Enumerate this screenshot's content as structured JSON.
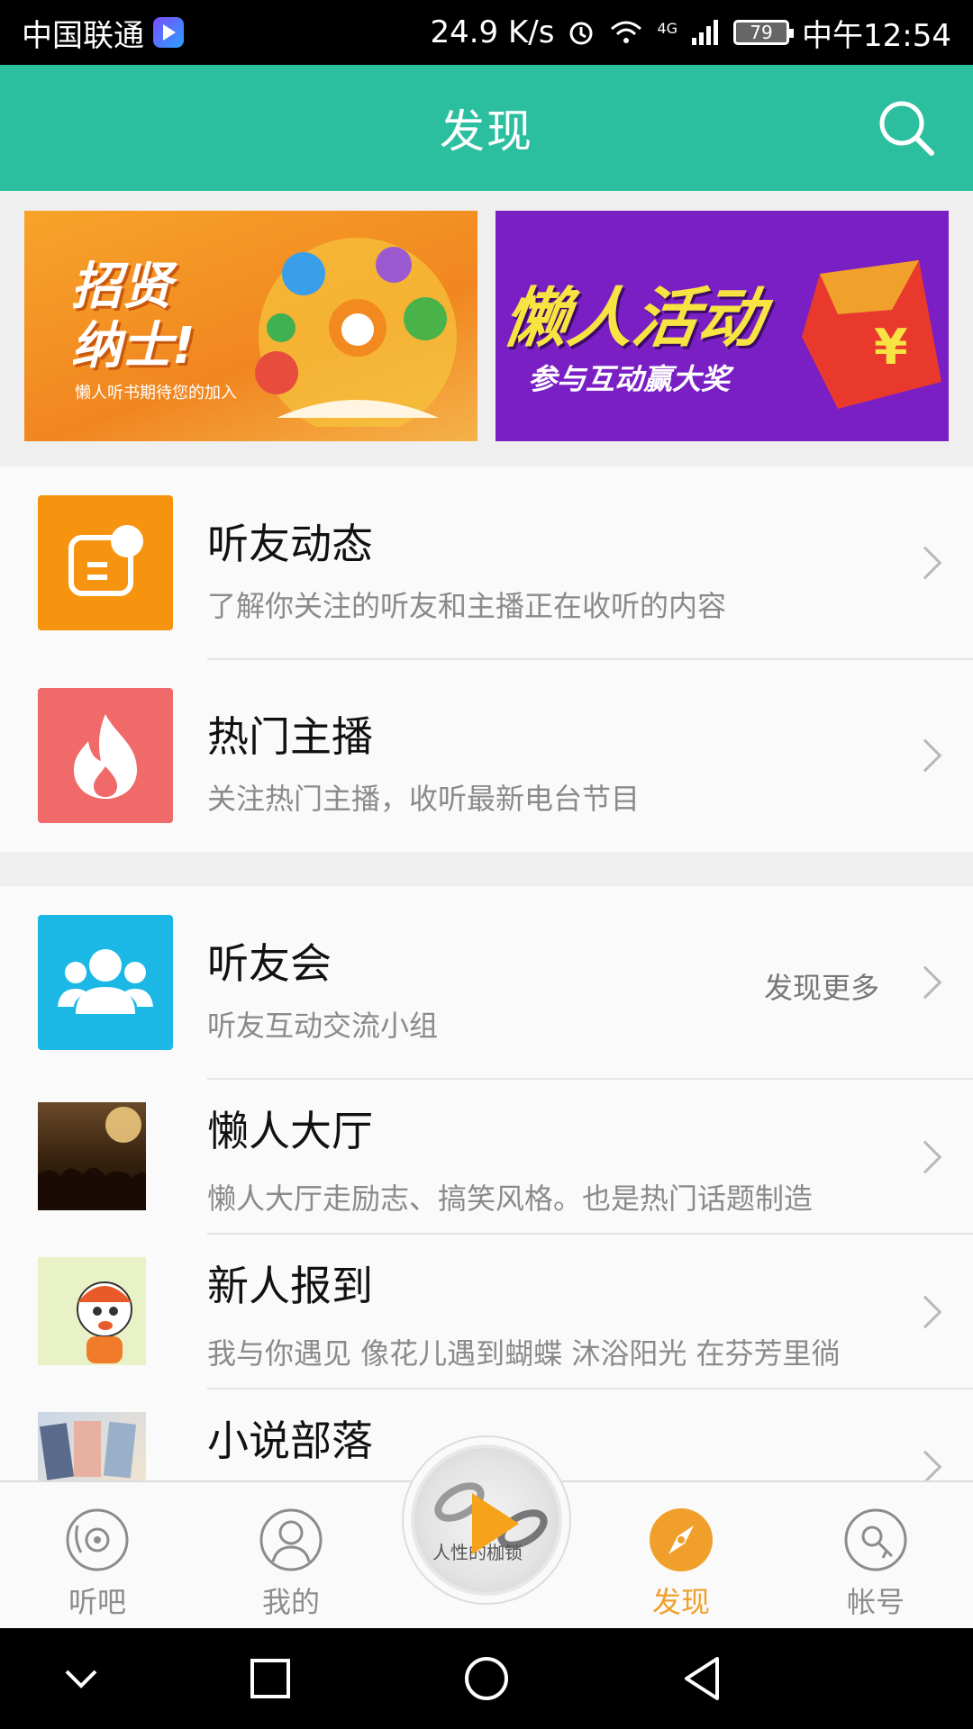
{
  "status_bar": {
    "carrier": "中国联通",
    "speed": "24.9 K/s",
    "network": "4G",
    "battery": "79",
    "time": "中午12:54"
  },
  "header": {
    "title": "发现"
  },
  "banners": [
    {
      "headline_line1": "招贤",
      "headline_line2": "纳士!",
      "subtitle": "懒人听书期待您的加入"
    },
    {
      "headline": "懒人活动",
      "subtitle": "参与互动赢大奖"
    }
  ],
  "section1": [
    {
      "title": "听友动态",
      "subtitle": "了解你关注的听友和主播正在收听的内容",
      "icon": "message-icon",
      "color": "#f7940f"
    },
    {
      "title": "热门主播",
      "subtitle": "关注热门主播，收听最新电台节目",
      "icon": "flame-icon",
      "color": "#f06a6a"
    }
  ],
  "section2": {
    "group": {
      "title": "听友会",
      "subtitle": "听友互动交流小组",
      "more": "发现更多",
      "icon": "group-icon",
      "color": "#1bb8e6"
    },
    "items": [
      {
        "title": "懒人大厅",
        "subtitle": "懒人大厅走励志、搞笑风格。也是热门话题制造"
      },
      {
        "title": "新人报到",
        "subtitle": "我与你遇见 像花儿遇到蝴蝶 沐浴阳光 在芬芳里徜"
      },
      {
        "title": "小说部落",
        "subtitle": ""
      }
    ]
  },
  "tabbar": {
    "tabs": [
      {
        "label": "听吧",
        "icon": "vinyl-icon"
      },
      {
        "label": "我的",
        "icon": "person-icon"
      },
      {
        "label": "发现",
        "icon": "compass-icon"
      },
      {
        "label": "帐号",
        "icon": "account-disc-icon"
      }
    ],
    "player_text": "人性的枷锁",
    "accent": "#f0a02a"
  }
}
